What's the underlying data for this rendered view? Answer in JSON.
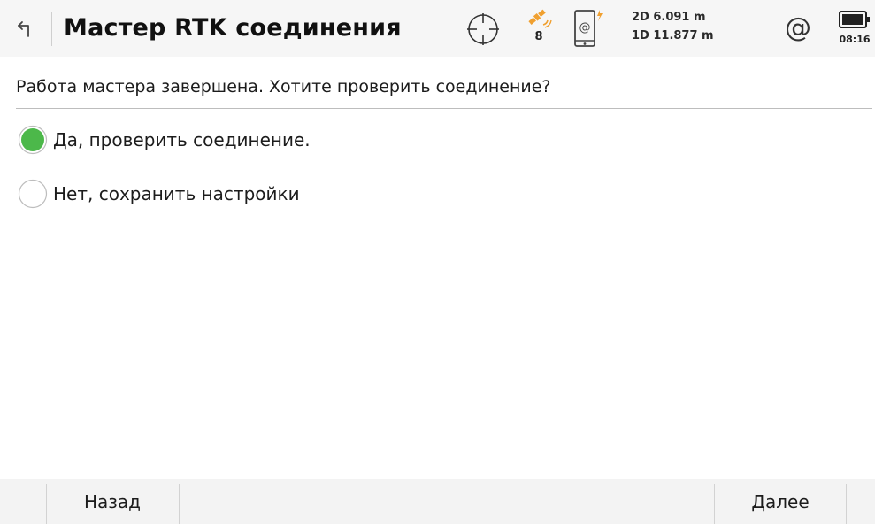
{
  "header": {
    "title": "Мастер RTK соединения",
    "satellite_count": "8",
    "precision_2d": "2D 6.091 m",
    "precision_1d": "1D 11.877 m",
    "connection_symbol": "@",
    "clock": "08:16"
  },
  "main": {
    "question": "Работа мастера завершена. Хотите проверить соединение?",
    "options": [
      {
        "label": "Да, проверить соединение.",
        "selected": true
      },
      {
        "label": "Нет, сохранить настройки",
        "selected": false
      }
    ]
  },
  "footer": {
    "back_label": "Назад",
    "next_label": "Далее"
  },
  "icons": {
    "back": "back-arrow-icon",
    "crosshair": "crosshair-icon",
    "satellite": "satellite-icon",
    "device": "device-at-icon",
    "lightning": "lightning-icon",
    "battery": "battery-icon"
  },
  "colors": {
    "accent_orange": "#f0a030",
    "radio_selected": "#4cb84a",
    "header_bg": "#f6f6f6",
    "footer_bg": "#f3f3f3"
  }
}
